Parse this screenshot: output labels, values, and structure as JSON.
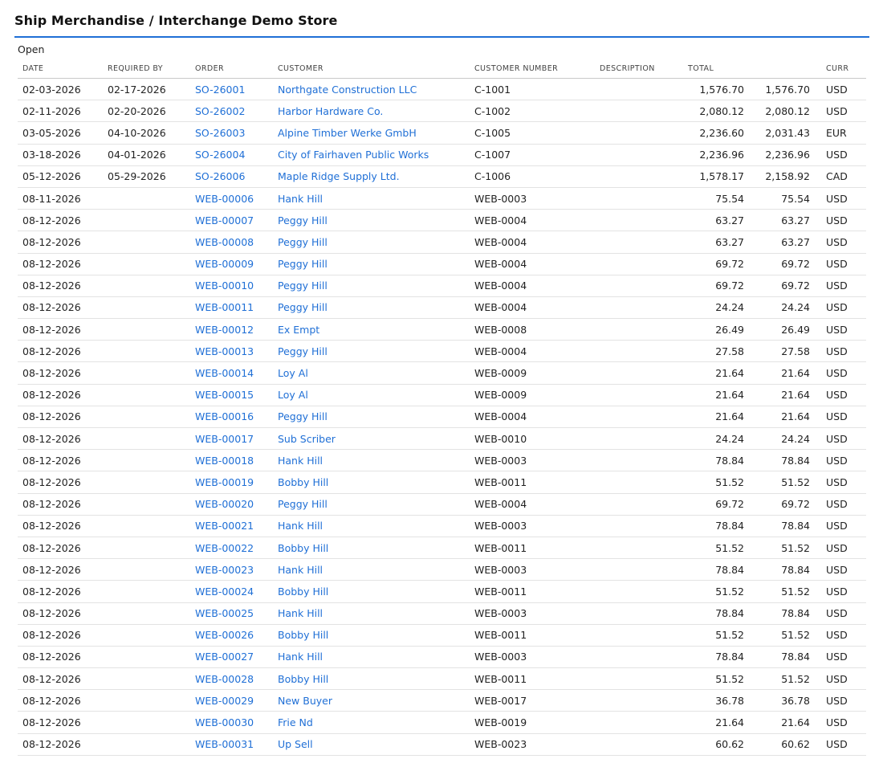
{
  "page": {
    "title": "Ship Merchandise / Interchange Demo Store",
    "section_label": "Open"
  },
  "columns": {
    "date": "DATE",
    "required_by": "REQUIRED BY",
    "order": "ORDER",
    "customer": "CUSTOMER",
    "customer_number": "CUSTOMER NUMBER",
    "description": "DESCRIPTION",
    "total": "TOTAL",
    "total2": "",
    "curr": "CURR"
  },
  "colors": {
    "link": "#1f6fd6",
    "accent_rule": "#1f6fd6"
  },
  "rows": [
    {
      "date": "02-03-2026",
      "required_by": "02-17-2026",
      "order": "SO-26001",
      "customer": "Northgate Construction LLC",
      "customer_number": "C-1001",
      "description": "",
      "total": "1,576.70",
      "total2": "1,576.70",
      "curr": "USD"
    },
    {
      "date": "02-11-2026",
      "required_by": "02-20-2026",
      "order": "SO-26002",
      "customer": "Harbor Hardware Co.",
      "customer_number": "C-1002",
      "description": "",
      "total": "2,080.12",
      "total2": "2,080.12",
      "curr": "USD"
    },
    {
      "date": "03-05-2026",
      "required_by": "04-10-2026",
      "order": "SO-26003",
      "customer": "Alpine Timber Werke GmbH",
      "customer_number": "C-1005",
      "description": "",
      "total": "2,236.60",
      "total2": "2,031.43",
      "curr": "EUR"
    },
    {
      "date": "03-18-2026",
      "required_by": "04-01-2026",
      "order": "SO-26004",
      "customer": "City of Fairhaven Public Works",
      "customer_number": "C-1007",
      "description": "",
      "total": "2,236.96",
      "total2": "2,236.96",
      "curr": "USD"
    },
    {
      "date": "05-12-2026",
      "required_by": "05-29-2026",
      "order": "SO-26006",
      "customer": "Maple Ridge Supply Ltd.",
      "customer_number": "C-1006",
      "description": "",
      "total": "1,578.17",
      "total2": "2,158.92",
      "curr": "CAD"
    },
    {
      "date": "08-11-2026",
      "required_by": "",
      "order": "WEB-00006",
      "customer": "Hank Hill",
      "customer_number": "WEB-0003",
      "description": "",
      "total": "75.54",
      "total2": "75.54",
      "curr": "USD"
    },
    {
      "date": "08-12-2026",
      "required_by": "",
      "order": "WEB-00007",
      "customer": "Peggy Hill",
      "customer_number": "WEB-0004",
      "description": "",
      "total": "63.27",
      "total2": "63.27",
      "curr": "USD"
    },
    {
      "date": "08-12-2026",
      "required_by": "",
      "order": "WEB-00008",
      "customer": "Peggy Hill",
      "customer_number": "WEB-0004",
      "description": "",
      "total": "63.27",
      "total2": "63.27",
      "curr": "USD"
    },
    {
      "date": "08-12-2026",
      "required_by": "",
      "order": "WEB-00009",
      "customer": "Peggy Hill",
      "customer_number": "WEB-0004",
      "description": "",
      "total": "69.72",
      "total2": "69.72",
      "curr": "USD"
    },
    {
      "date": "08-12-2026",
      "required_by": "",
      "order": "WEB-00010",
      "customer": "Peggy Hill",
      "customer_number": "WEB-0004",
      "description": "",
      "total": "69.72",
      "total2": "69.72",
      "curr": "USD"
    },
    {
      "date": "08-12-2026",
      "required_by": "",
      "order": "WEB-00011",
      "customer": "Peggy Hill",
      "customer_number": "WEB-0004",
      "description": "",
      "total": "24.24",
      "total2": "24.24",
      "curr": "USD"
    },
    {
      "date": "08-12-2026",
      "required_by": "",
      "order": "WEB-00012",
      "customer": "Ex Empt",
      "customer_number": "WEB-0008",
      "description": "",
      "total": "26.49",
      "total2": "26.49",
      "curr": "USD"
    },
    {
      "date": "08-12-2026",
      "required_by": "",
      "order": "WEB-00013",
      "customer": "Peggy Hill",
      "customer_number": "WEB-0004",
      "description": "",
      "total": "27.58",
      "total2": "27.58",
      "curr": "USD"
    },
    {
      "date": "08-12-2026",
      "required_by": "",
      "order": "WEB-00014",
      "customer": "Loy Al",
      "customer_number": "WEB-0009",
      "description": "",
      "total": "21.64",
      "total2": "21.64",
      "curr": "USD"
    },
    {
      "date": "08-12-2026",
      "required_by": "",
      "order": "WEB-00015",
      "customer": "Loy Al",
      "customer_number": "WEB-0009",
      "description": "",
      "total": "21.64",
      "total2": "21.64",
      "curr": "USD"
    },
    {
      "date": "08-12-2026",
      "required_by": "",
      "order": "WEB-00016",
      "customer": "Peggy Hill",
      "customer_number": "WEB-0004",
      "description": "",
      "total": "21.64",
      "total2": "21.64",
      "curr": "USD"
    },
    {
      "date": "08-12-2026",
      "required_by": "",
      "order": "WEB-00017",
      "customer": "Sub Scriber",
      "customer_number": "WEB-0010",
      "description": "",
      "total": "24.24",
      "total2": "24.24",
      "curr": "USD"
    },
    {
      "date": "08-12-2026",
      "required_by": "",
      "order": "WEB-00018",
      "customer": "Hank Hill",
      "customer_number": "WEB-0003",
      "description": "",
      "total": "78.84",
      "total2": "78.84",
      "curr": "USD"
    },
    {
      "date": "08-12-2026",
      "required_by": "",
      "order": "WEB-00019",
      "customer": "Bobby Hill",
      "customer_number": "WEB-0011",
      "description": "",
      "total": "51.52",
      "total2": "51.52",
      "curr": "USD"
    },
    {
      "date": "08-12-2026",
      "required_by": "",
      "order": "WEB-00020",
      "customer": "Peggy Hill",
      "customer_number": "WEB-0004",
      "description": "",
      "total": "69.72",
      "total2": "69.72",
      "curr": "USD"
    },
    {
      "date": "08-12-2026",
      "required_by": "",
      "order": "WEB-00021",
      "customer": "Hank Hill",
      "customer_number": "WEB-0003",
      "description": "",
      "total": "78.84",
      "total2": "78.84",
      "curr": "USD"
    },
    {
      "date": "08-12-2026",
      "required_by": "",
      "order": "WEB-00022",
      "customer": "Bobby Hill",
      "customer_number": "WEB-0011",
      "description": "",
      "total": "51.52",
      "total2": "51.52",
      "curr": "USD"
    },
    {
      "date": "08-12-2026",
      "required_by": "",
      "order": "WEB-00023",
      "customer": "Hank Hill",
      "customer_number": "WEB-0003",
      "description": "",
      "total": "78.84",
      "total2": "78.84",
      "curr": "USD"
    },
    {
      "date": "08-12-2026",
      "required_by": "",
      "order": "WEB-00024",
      "customer": "Bobby Hill",
      "customer_number": "WEB-0011",
      "description": "",
      "total": "51.52",
      "total2": "51.52",
      "curr": "USD"
    },
    {
      "date": "08-12-2026",
      "required_by": "",
      "order": "WEB-00025",
      "customer": "Hank Hill",
      "customer_number": "WEB-0003",
      "description": "",
      "total": "78.84",
      "total2": "78.84",
      "curr": "USD"
    },
    {
      "date": "08-12-2026",
      "required_by": "",
      "order": "WEB-00026",
      "customer": "Bobby Hill",
      "customer_number": "WEB-0011",
      "description": "",
      "total": "51.52",
      "total2": "51.52",
      "curr": "USD"
    },
    {
      "date": "08-12-2026",
      "required_by": "",
      "order": "WEB-00027",
      "customer": "Hank Hill",
      "customer_number": "WEB-0003",
      "description": "",
      "total": "78.84",
      "total2": "78.84",
      "curr": "USD"
    },
    {
      "date": "08-12-2026",
      "required_by": "",
      "order": "WEB-00028",
      "customer": "Bobby Hill",
      "customer_number": "WEB-0011",
      "description": "",
      "total": "51.52",
      "total2": "51.52",
      "curr": "USD"
    },
    {
      "date": "08-12-2026",
      "required_by": "",
      "order": "WEB-00029",
      "customer": "New Buyer",
      "customer_number": "WEB-0017",
      "description": "",
      "total": "36.78",
      "total2": "36.78",
      "curr": "USD"
    },
    {
      "date": "08-12-2026",
      "required_by": "",
      "order": "WEB-00030",
      "customer": "Frie Nd",
      "customer_number": "WEB-0019",
      "description": "",
      "total": "21.64",
      "total2": "21.64",
      "curr": "USD"
    },
    {
      "date": "08-12-2026",
      "required_by": "",
      "order": "WEB-00031",
      "customer": "Up Sell",
      "customer_number": "WEB-0023",
      "description": "",
      "total": "60.62",
      "total2": "60.62",
      "curr": "USD"
    }
  ]
}
